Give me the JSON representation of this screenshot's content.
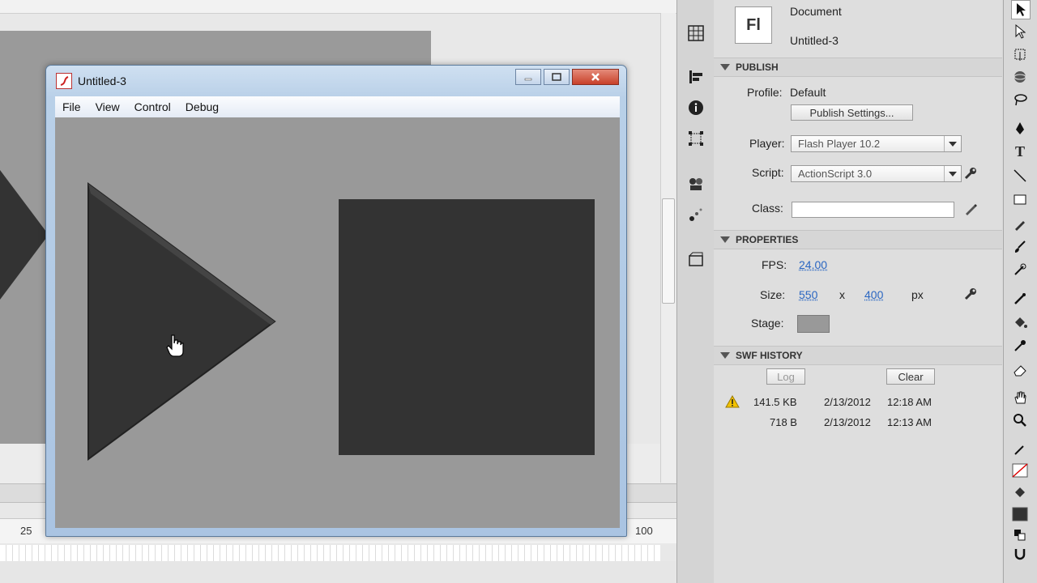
{
  "background": {
    "ruler_numbers": [
      "25",
      "100"
    ]
  },
  "player_window": {
    "title": "Untitled-3",
    "menu": [
      "File",
      "View",
      "Control",
      "Debug"
    ],
    "stage_color": "#999999",
    "shape_color": "#333333"
  },
  "properties": {
    "doc_icon": "Fl",
    "doc_type": "Document",
    "doc_name": "Untitled-3",
    "publish": {
      "header": "PUBLISH",
      "profile_label": "Profile:",
      "profile_value": "Default",
      "publish_settings_button": "Publish Settings...",
      "player_label": "Player:",
      "player_value": "Flash Player 10.2",
      "script_label": "Script:",
      "script_value": "ActionScript 3.0",
      "class_label": "Class:",
      "class_value": ""
    },
    "props": {
      "header": "PROPERTIES",
      "fps_label": "FPS:",
      "fps_value": "24.00",
      "size_label": "Size:",
      "width": "550",
      "x": "x",
      "height": "400",
      "unit": "px",
      "stage_label": "Stage:",
      "stage_color": "#999999"
    },
    "history": {
      "header": "SWF HISTORY",
      "log_button": "Log",
      "clear_button": "Clear",
      "entries": [
        {
          "size": "141.5 KB",
          "date": "2/13/2012",
          "time": "12:18 AM",
          "warning": true
        },
        {
          "size": "718 B",
          "date": "2/13/2012",
          "time": "12:13 AM",
          "warning": false
        }
      ]
    }
  }
}
